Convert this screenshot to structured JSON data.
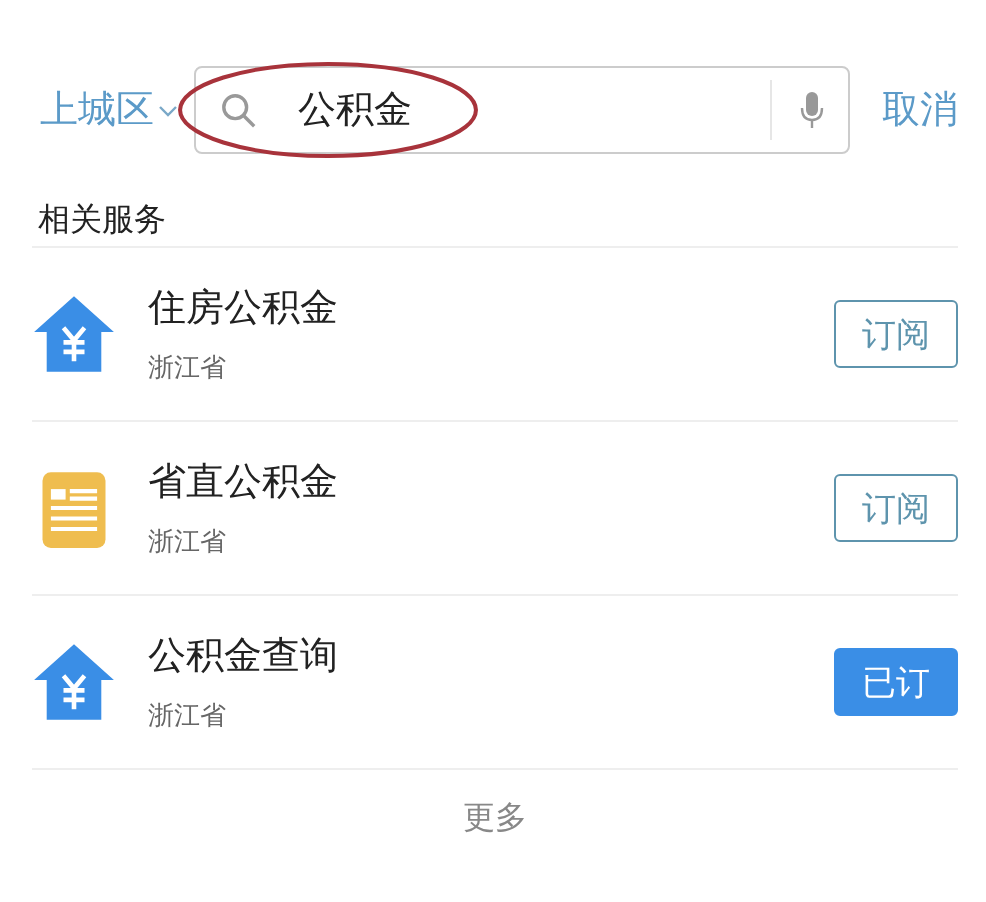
{
  "location": {
    "label": "上城区"
  },
  "search": {
    "value": "公积金",
    "highlighted": true
  },
  "cancel": "取消",
  "section_title": "相关服务",
  "services": [
    {
      "kind": "house",
      "title": "住房公积金",
      "region": "浙江省",
      "button": "订阅",
      "subscribed": false
    },
    {
      "kind": "clipboard",
      "title": "省直公积金",
      "region": "浙江省",
      "button": "订阅",
      "subscribed": false
    },
    {
      "kind": "house",
      "title": "公积金查询",
      "region": "浙江省",
      "button": "已订",
      "subscribed": true
    }
  ],
  "more": "更多"
}
